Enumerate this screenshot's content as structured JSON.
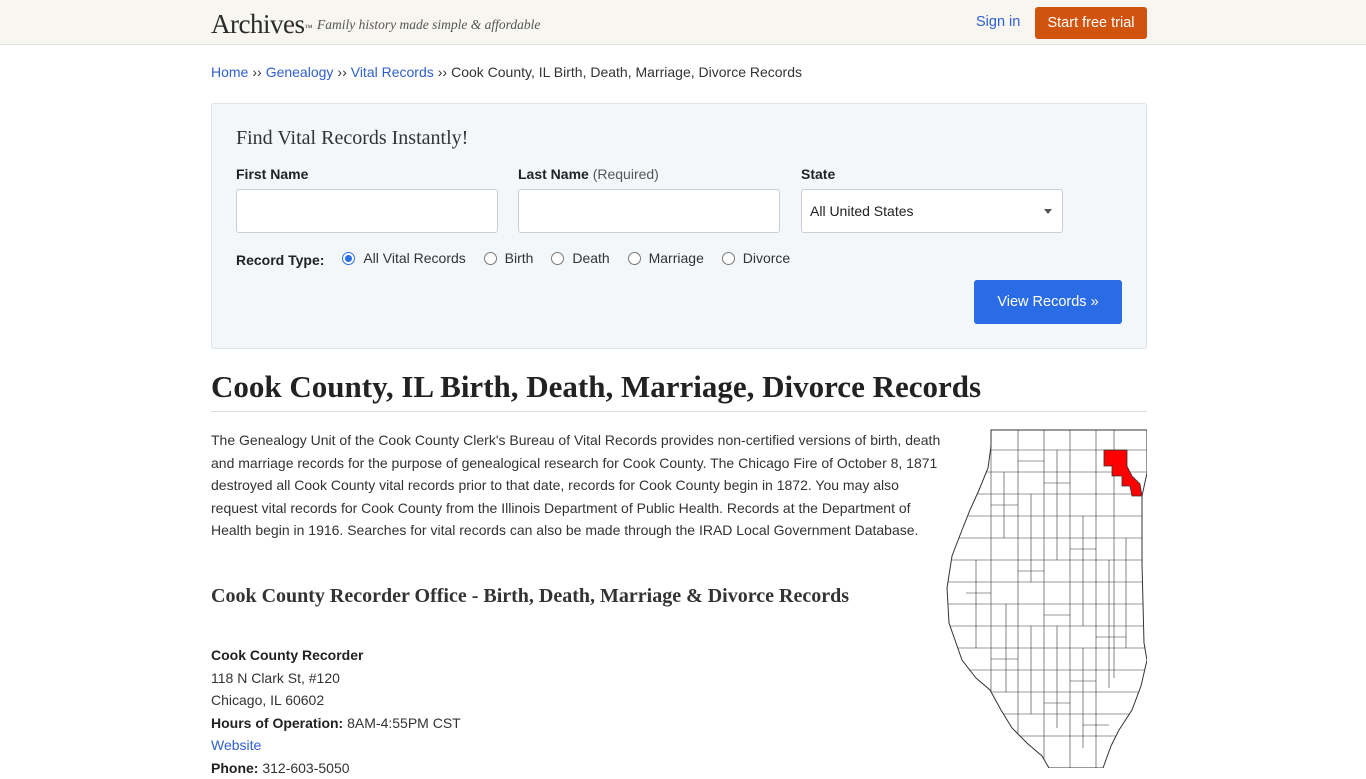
{
  "header": {
    "logo": "Archives",
    "logo_mark": "™",
    "tagline": "Family history made simple & affordable",
    "signin": "Sign in",
    "trial": "Start free trial"
  },
  "breadcrumb": {
    "items": [
      "Home",
      "Genealogy",
      "Vital Records"
    ],
    "separator": "››",
    "current": "Cook County, IL Birth, Death, Marriage, Divorce Records"
  },
  "search": {
    "title": "Find Vital Records Instantly!",
    "first_name_label": "First Name",
    "last_name_label": "Last Name",
    "last_name_required": "(Required)",
    "state_label": "State",
    "state_value": "All United States",
    "record_type_label": "Record Type:",
    "record_types": [
      "All Vital Records",
      "Birth",
      "Death",
      "Marriage",
      "Divorce"
    ],
    "selected_record_type": "All Vital Records",
    "submit": "View Records »"
  },
  "main": {
    "title": "Cook County, IL Birth, Death, Marriage, Divorce Records",
    "intro": "The Genealogy Unit of the Cook County Clerk's Bureau of Vital Records provides non-certified versions of birth, death and marriage records for the purpose of genealogical research for Cook County. The Chicago Fire of October 8, 1871 destroyed all Cook County vital records prior to that date, records for Cook County begin in 1872. You may also request vital records for Cook County from the Illinois Department of Public Health. Records at the Department of Health begin in 1916. Searches for vital records can also be made through the IRAD Local Government Database.",
    "section_title": "Cook County Recorder Office - Birth, Death, Marriage & Divorce Records"
  },
  "office": {
    "name": "Cook County Recorder",
    "address1": "118 N Clark St, #120",
    "address2": "Chicago, IL 60602",
    "hours_label": "Hours of Operation:",
    "hours": "8AM-4:55PM CST",
    "website": "Website",
    "phone_label": "Phone:",
    "phone": "312-603-5050"
  },
  "map": {
    "highlight_color": "#ff0000",
    "lake_color": "#9999ff",
    "county_fill": "#ffffff"
  }
}
